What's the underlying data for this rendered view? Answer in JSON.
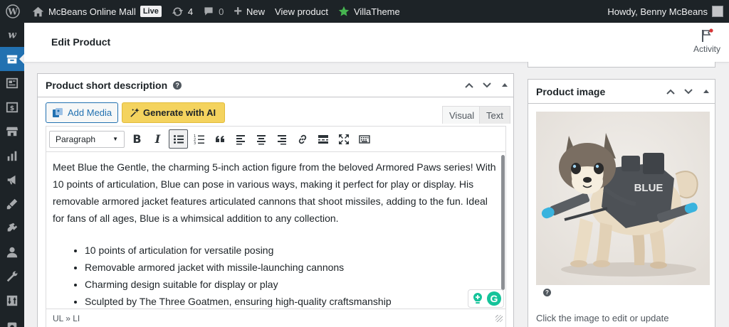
{
  "adminbar": {
    "site_name": "McBeans Online Mall",
    "live_badge": "Live",
    "updates_count": "4",
    "comments_count": "0",
    "new_label": "New",
    "view_product_label": "View product",
    "villatheme_label": "VillaTheme",
    "howdy": "Howdy, Benny McBeans"
  },
  "sidebar": {
    "items": [
      "wordpress-logo",
      "woo",
      "products",
      "pages",
      "payments",
      "store",
      "analytics",
      "marketing",
      "appearance",
      "plugins",
      "users",
      "tools",
      "settings",
      "misc"
    ],
    "active": "products"
  },
  "header": {
    "title": "Edit Product",
    "activity_label": "Activity"
  },
  "short_description": {
    "title": "Product short description",
    "help": "?",
    "add_media_label": "Add Media",
    "generate_ai_label": "Generate with AI",
    "tab_visual": "Visual",
    "tab_text": "Text",
    "format_select": "Paragraph",
    "paragraph": "Meet Blue the Gentle, the charming 5-inch action figure from the beloved Armored Paws series! With 10 points of articulation, Blue can pose in various ways, making it perfect for play or display. His removable armored jacket features articulated cannons that shoot missiles, adding to the fun. Ideal for fans of all ages, Blue is a whimsical addition to any collection.",
    "bullets": [
      "10 points of articulation for versatile posing",
      "Removable armored jacket with missile-launching cannons",
      "Charming design suitable for display or play",
      "Sculpted by The Three Goatmen, ensuring high-quality craftsmanship"
    ],
    "status_path": "UL » LI"
  },
  "product_image": {
    "title": "Product image",
    "jacket_text": "BLUE",
    "help": "?",
    "hint": "Click the image to edit or update"
  },
  "colors": {
    "adminbar_bg": "#1d2327",
    "accent": "#2271b1",
    "ai_button": "#f4d35e",
    "grammarly": "#15c39a"
  }
}
